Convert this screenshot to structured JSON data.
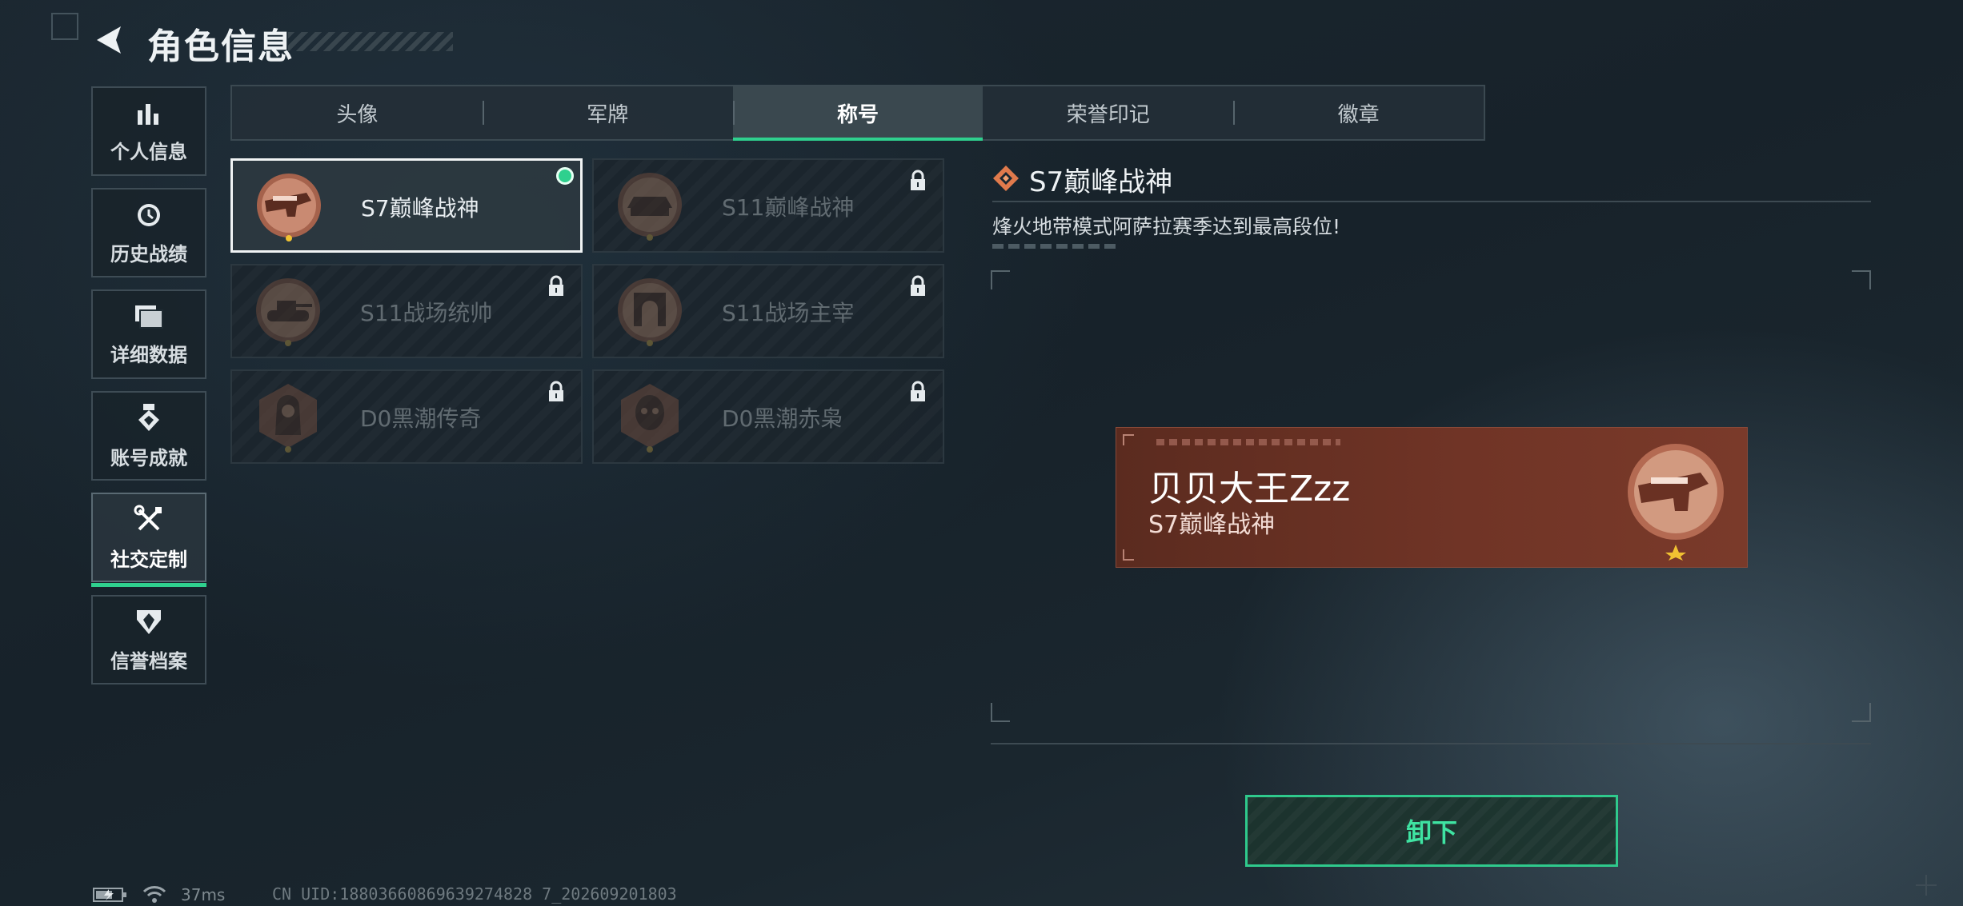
{
  "header": {
    "title": "角色信息"
  },
  "sidebar": {
    "items": [
      {
        "label": "个人信息",
        "icon": "bar-chart-icon",
        "active": false
      },
      {
        "label": "历史战绩",
        "icon": "history-clock-icon",
        "active": false
      },
      {
        "label": "详细数据",
        "icon": "folder-icon",
        "active": false
      },
      {
        "label": "账号成就",
        "icon": "medal-icon",
        "active": false
      },
      {
        "label": "社交定制",
        "icon": "tools-icon",
        "active": true
      },
      {
        "label": "信誉档案",
        "icon": "shield-emblem-icon",
        "active": false
      }
    ]
  },
  "tabs": [
    {
      "label": "头像",
      "active": false
    },
    {
      "label": "军牌",
      "active": false
    },
    {
      "label": "称号",
      "active": true
    },
    {
      "label": "荣誉印记",
      "active": false
    },
    {
      "label": "徽章",
      "active": false
    }
  ],
  "titles": [
    {
      "name": "S7巅峰战神",
      "emblem": "rifle-emblem-icon",
      "selected": true,
      "locked": false
    },
    {
      "name": "S11巅峰战神",
      "emblem": "armored-car-emblem-icon",
      "selected": false,
      "locked": true
    },
    {
      "name": "S11战场统帅",
      "emblem": "tank-emblem-icon",
      "selected": false,
      "locked": true
    },
    {
      "name": "S11战场主宰",
      "emblem": "arch-emblem-icon",
      "selected": false,
      "locked": true
    },
    {
      "name": "D0黑潮传奇",
      "emblem": "hooded-figure-emblem-icon",
      "selected": false,
      "locked": true
    },
    {
      "name": "D0黑潮赤枭",
      "emblem": "skull-emblem-icon",
      "selected": false,
      "locked": true
    }
  ],
  "detail": {
    "title": "S7巅峰战神",
    "description": "烽火地带模式阿萨拉赛季达到最高段位!"
  },
  "nameplate": {
    "player_name": "贝贝大王Zzz",
    "title": "S7巅峰战神"
  },
  "actions": {
    "unequip_label": "卸下"
  },
  "status": {
    "ping": "37ms",
    "uid": "CN UID:18803660869639274828 7_202609201803"
  },
  "colors": {
    "accent": "#2fd08e",
    "nameplate_bg": "#703426",
    "background": "#1b2730"
  }
}
